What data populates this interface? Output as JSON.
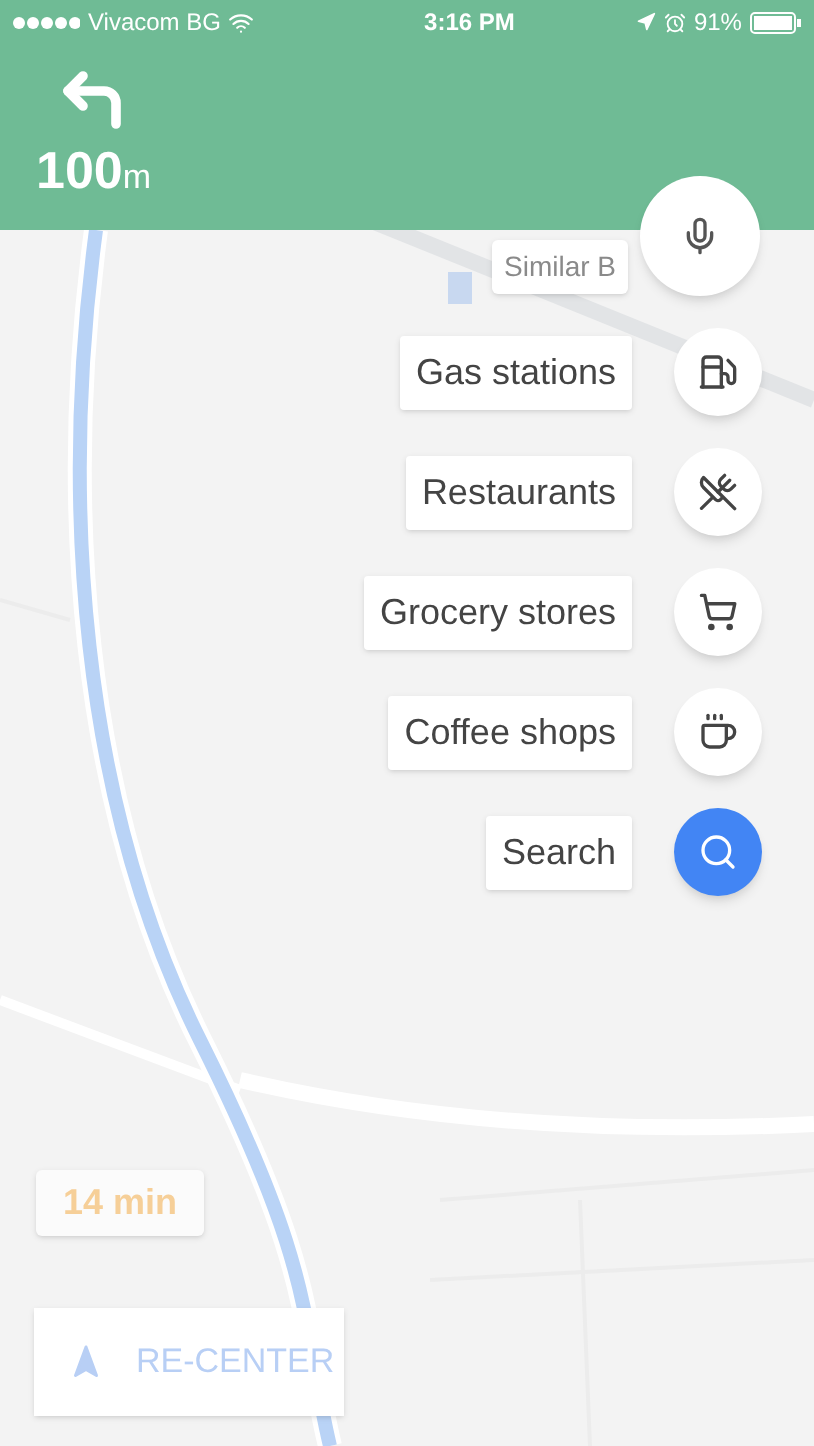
{
  "status_bar": {
    "carrier": "Vivacom BG",
    "time": "3:16 PM",
    "battery": "91%"
  },
  "navigation": {
    "distance": "100",
    "unit": "m"
  },
  "map_callout": "Similar B",
  "categories": [
    {
      "label": "Gas stations",
      "kind": "gas"
    },
    {
      "label": "Restaurants",
      "kind": "restaurant"
    },
    {
      "label": "Grocery stores",
      "kind": "grocery"
    },
    {
      "label": "Coffee shops",
      "kind": "coffee"
    },
    {
      "label": "Search",
      "kind": "search"
    }
  ],
  "eta": "14 min",
  "recenter_button": "RE-CENTER"
}
